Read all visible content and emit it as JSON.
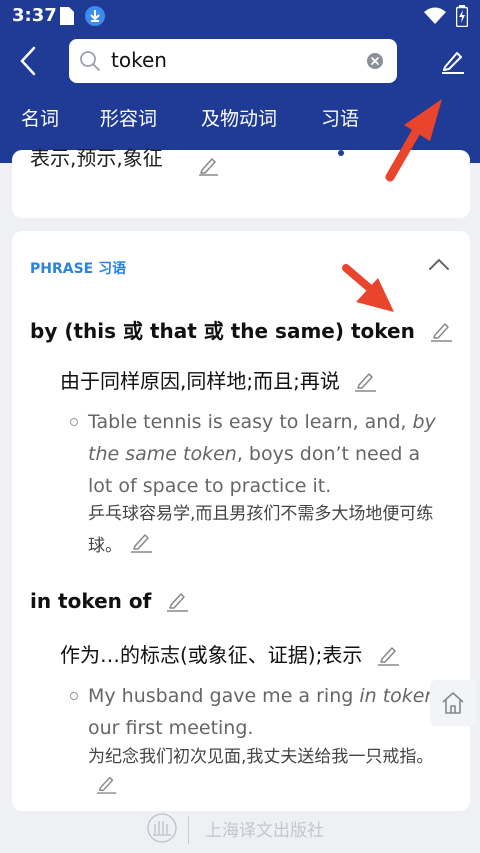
{
  "status_bar": {
    "time": "3:37"
  },
  "search": {
    "query": "token"
  },
  "tabs": [
    {
      "label": "名词",
      "selected": false
    },
    {
      "label": "形容词",
      "selected": false
    },
    {
      "label": "及物动词",
      "selected": false
    },
    {
      "label": "习语",
      "selected": true
    }
  ],
  "prev_card": {
    "clipped_text": "表示,预示,象征"
  },
  "phrase_section": {
    "header": "PHRASE 习语",
    "entries": [
      {
        "phrase": "by (this 或 that 或 the same) token",
        "sense": "由于同样原因,同样地;而且;再说",
        "example_before": "Table tennis is easy to learn, and, ",
        "example_italic": "by the same token",
        "example_after": ", boys don’t need a lot of space to practice it.",
        "translation": "乒乓球容易学,而且男孩们不需多大场地便可练球。"
      },
      {
        "phrase": "in token of",
        "sense": "作为…的标志(或象征、证据);表示",
        "example_before": "My husband gave me a ring ",
        "example_italic": "in token",
        "example_after": " our first meeting.",
        "translation": "为纪念我们初次见面,我丈夫送给我一只戒指。"
      }
    ]
  },
  "footer": {
    "publisher": "上海译文出版社"
  },
  "colors": {
    "primary": "#1f3b95",
    "accent": "#2a83e0",
    "arrow": "#e8452c"
  }
}
